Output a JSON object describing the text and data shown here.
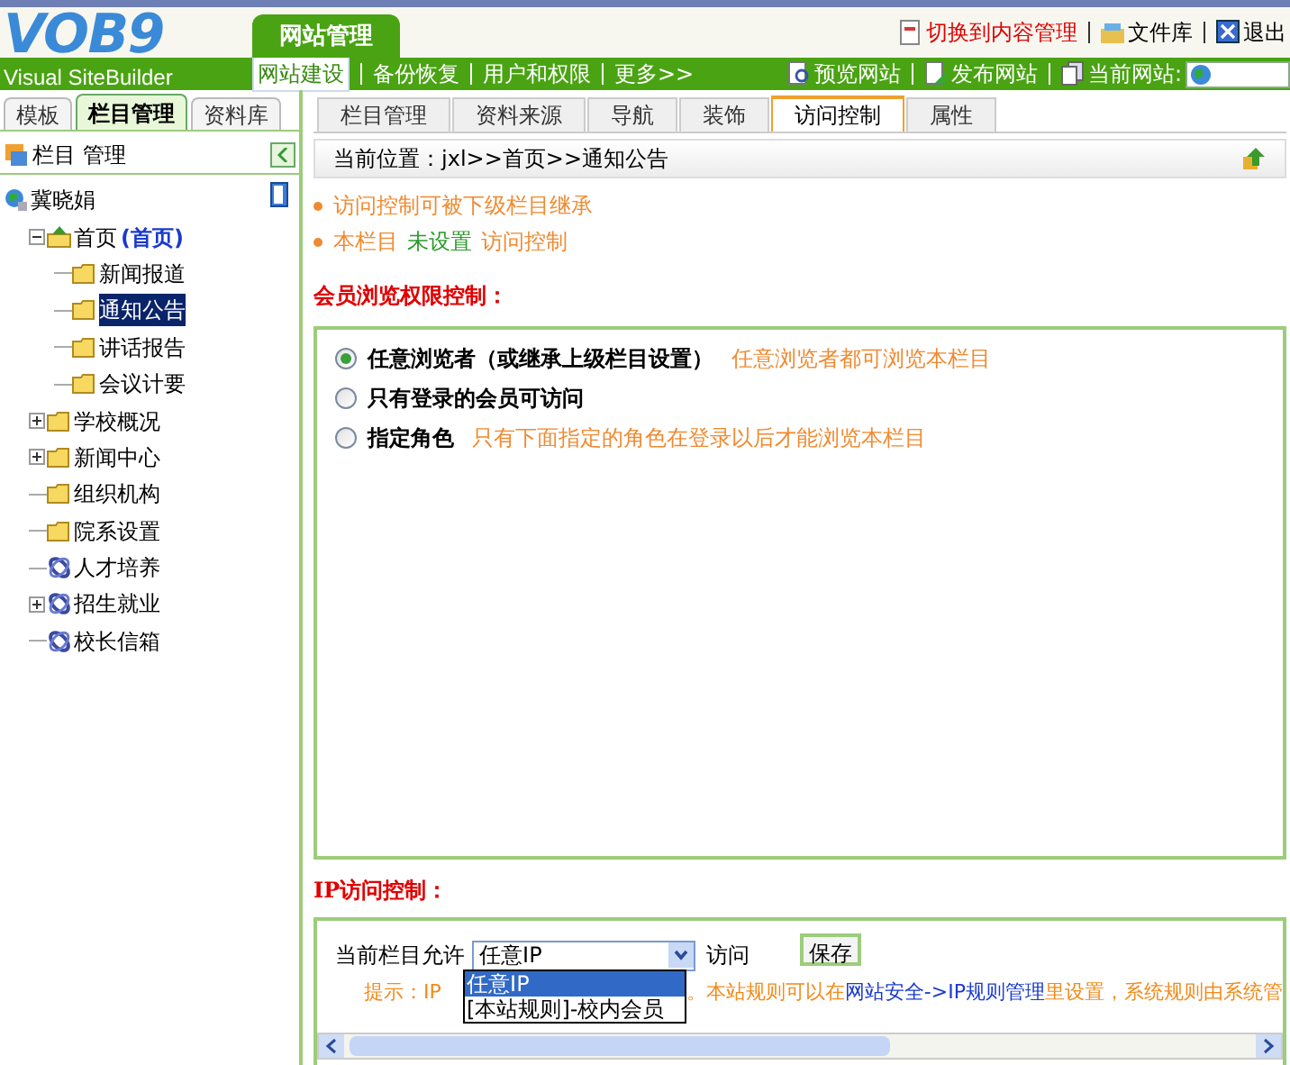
{
  "logo": {
    "mark": "VOB9",
    "subtitle": "Visual SiteBuilder"
  },
  "main_tab": {
    "label": "网站管理",
    "selected": true
  },
  "top_links": [
    {
      "label": "切换到内容管理",
      "kind": "switch"
    },
    {
      "label": "文件库",
      "kind": "library"
    },
    {
      "label": "退出",
      "kind": "exit"
    }
  ],
  "menu": [
    {
      "label": "网站建设",
      "selected": true
    },
    {
      "label": "备份恢复",
      "selected": false
    },
    {
      "label": "用户和权限",
      "selected": false
    },
    {
      "label": "更多>>",
      "selected": false
    }
  ],
  "actions": [
    {
      "label": "预览网站",
      "kind": "preview"
    },
    {
      "label": "发布网站",
      "kind": "publish"
    },
    {
      "label": "当前网站:",
      "kind": "site"
    }
  ],
  "sidebar": {
    "tabs": [
      {
        "label": "模板",
        "selected": false
      },
      {
        "label": "栏目管理",
        "selected": true
      },
      {
        "label": "资料库",
        "selected": false
      }
    ],
    "header": "栏目 管理",
    "tree": [
      {
        "label": "冀晓娟",
        "kind": "site",
        "children": [
          {
            "label": "首页",
            "note": "(首页)",
            "kind": "home",
            "expanded": true,
            "children": [
              {
                "label": "新闻报道",
                "kind": "folder",
                "selected": false
              },
              {
                "label": "通知公告",
                "kind": "folder",
                "selected": true
              },
              {
                "label": "讲话报告",
                "kind": "folder",
                "selected": false
              },
              {
                "label": "会议计要",
                "kind": "folder",
                "selected": false
              }
            ]
          },
          {
            "label": "学校概况",
            "kind": "folder",
            "expanded": false
          },
          {
            "label": "新闻中心",
            "kind": "folder",
            "expanded": false
          },
          {
            "label": "组织机构",
            "kind": "folder"
          },
          {
            "label": "院系设置",
            "kind": "folder"
          },
          {
            "label": "人才培养",
            "kind": "link"
          },
          {
            "label": "招生就业",
            "kind": "link",
            "expanded": false
          },
          {
            "label": "校长信箱",
            "kind": "link"
          }
        ]
      }
    ]
  },
  "tabs": [
    {
      "label": "栏目管理",
      "selected": false
    },
    {
      "label": "资料来源",
      "selected": false
    },
    {
      "label": "导航",
      "selected": false
    },
    {
      "label": "装饰",
      "selected": false
    },
    {
      "label": "访问控制",
      "selected": true
    },
    {
      "label": "属性",
      "selected": false
    }
  ],
  "breadcrumb": "当前位置：jxl>>首页>>通知公告",
  "notes": [
    {
      "parts": [
        {
          "text": "访问控制可被下级栏目继承",
          "kind": "orange"
        }
      ]
    },
    {
      "parts": [
        {
          "text": "本栏目",
          "kind": "orange"
        },
        {
          "text": "未设置",
          "kind": "green"
        },
        {
          "text": "访问控制",
          "kind": "orange"
        }
      ]
    }
  ],
  "member_section": {
    "title": "会员浏览权限控制：",
    "options": [
      {
        "label": "任意浏览者（或继承上级栏目设置）",
        "hint": "任意浏览者都可浏览本栏目",
        "selected": true
      },
      {
        "label": "只有登录的会员可访问",
        "selected": false
      },
      {
        "label": "指定角色",
        "hint": "只有下面指定的角色在登录以后才能浏览本栏目",
        "selected": false
      }
    ]
  },
  "ip_section": {
    "title": "IP访问控制：",
    "prefix": "当前栏目允许",
    "select_value": "任意IP",
    "suffix": "访问",
    "save": "保存",
    "dropdown": [
      {
        "label": "任意IP",
        "selected": true
      },
      {
        "label": "[本站规则]-校内会员",
        "selected": false
      }
    ],
    "hint_start": "提示：IP",
    "hint_rest": "。本站规则可以在",
    "hint_link": "网站安全->IP规则管理",
    "hint_end": "里设置，系统规则由系统管"
  }
}
